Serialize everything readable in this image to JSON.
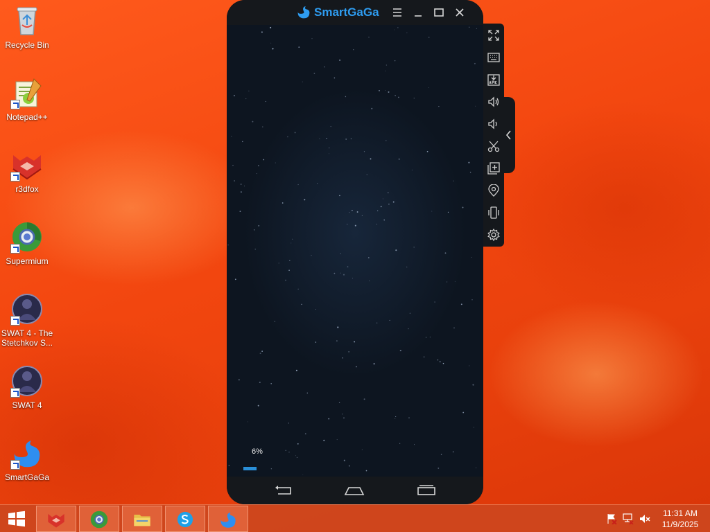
{
  "desktop": {
    "icons": [
      {
        "label": "Recycle Bin",
        "icon": "recycle-bin-icon"
      },
      {
        "label": "Notepad++",
        "icon": "notepad-plus-plus-icon"
      },
      {
        "label": "r3dfox",
        "icon": "r3dfox-icon"
      },
      {
        "label": "Supermium",
        "icon": "supermium-icon"
      },
      {
        "label": "SWAT 4 - The Stetchkov S...",
        "icon": "swat4-stetchkov-icon"
      },
      {
        "label": "SWAT 4",
        "icon": "swat4-icon"
      },
      {
        "label": "SmartGaGa",
        "icon": "smartgaga-icon"
      }
    ]
  },
  "emulator": {
    "title": "SmartGaGa",
    "brand_color": "#2e9cf0",
    "title_controls": [
      "menu-icon",
      "minimize-icon",
      "maximize-icon",
      "close-icon"
    ],
    "loading": {
      "progress_label": "6%",
      "progress_fraction": 0.06
    },
    "nav_buttons": [
      "back-icon",
      "home-icon",
      "recents-icon"
    ],
    "side_toolbar": [
      "fullscreen-icon",
      "keyboard-icon",
      "install-apk-icon",
      "volume-up-icon",
      "volume-down-icon",
      "screenshot-scissors-icon",
      "multi-instance-icon",
      "location-icon",
      "shake-icon",
      "settings-icon"
    ],
    "collapse_tab": "chevron-left-icon"
  },
  "taskbar": {
    "start": "windows-start-icon",
    "pinned": [
      "r3dfox-icon",
      "supermium-icon",
      "file-explorer-icon",
      "skype-icon",
      "smartgaga-icon"
    ],
    "tray": [
      "action-center-flag-icon",
      "network-icon",
      "volume-muted-icon"
    ],
    "time": "11:31 AM",
    "date": "11/9/2025"
  }
}
